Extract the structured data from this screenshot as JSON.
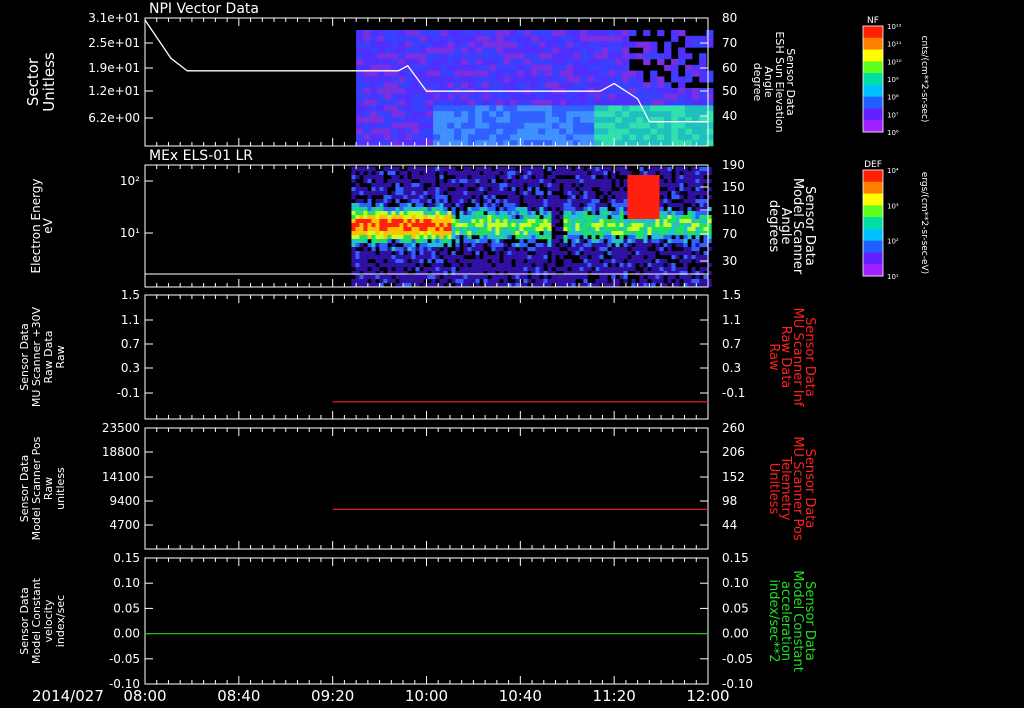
{
  "footer": {
    "date": "2014/027",
    "time_ticks": [
      "08:00",
      "08:40",
      "09:20",
      "10:00",
      "10:40",
      "11:20",
      "12:00"
    ]
  },
  "colors": {
    "red": "#ff2020",
    "green": "#20e020",
    "white": "#ffffff"
  },
  "chart_data": [
    {
      "type": "heatmap",
      "title": "NPI Vector Data",
      "ylabel": [
        "Sector",
        "Unitless"
      ],
      "yticks": [
        "3.1e+01",
        "2.5e+01",
        "1.9e+01",
        "1.2e+01",
        "6.2e+00"
      ],
      "y2label": [
        "Sensor Data",
        "ESH Sun Elevation",
        "Angle",
        "degree"
      ],
      "y2ticks": [
        "80",
        "70",
        "60",
        "50",
        "40"
      ],
      "y2lim": [
        32,
        80
      ],
      "overlay_line": {
        "x": [
          "08:00",
          "08:11",
          "08:18",
          "09:40",
          "09:48",
          "09:52",
          "10:00",
          "10:35",
          "11:14",
          "11:20",
          "11:30",
          "11:35",
          "12:00"
        ],
        "y": [
          80,
          65,
          60,
          60,
          60,
          62,
          52,
          52,
          52,
          55,
          49,
          40,
          40
        ]
      },
      "colorbar": {
        "label": "NF",
        "units": "cnts/(cm**2-sr-sec)",
        "ticks": [
          "10¹²",
          "10¹¹",
          "10¹⁰",
          "10⁹",
          "10⁸",
          "10⁷",
          "10⁶"
        ]
      }
    },
    {
      "type": "heatmap",
      "title": "MEx ELS-01 LR",
      "ylabel": [
        "Electron Energy",
        "eV"
      ],
      "yticks": [
        "10²",
        "10¹"
      ],
      "y2label": [
        "Sensor Data",
        "Model Scanner",
        "Angle",
        "degrees"
      ],
      "y2ticks": [
        "190",
        "150",
        "110",
        "70",
        "30"
      ],
      "y2lim": [
        0,
        190
      ],
      "overlay_line": {
        "x": [
          "08:00",
          "12:00"
        ],
        "y": [
          8,
          8
        ]
      },
      "colorbar": {
        "label": "DEF",
        "units": "ergs/(cm**2-sr-sec-eV)",
        "ticks": [
          "10⁴",
          "10³",
          "10²",
          "10¹"
        ]
      }
    },
    {
      "type": "line",
      "ylabel": [
        "Sensor Data",
        "MU Scanner +30V",
        "Raw Data",
        "Raw"
      ],
      "yticks": [
        "1.5",
        "1.1",
        "0.7",
        "0.3",
        "-0.1"
      ],
      "ylim": [
        -0.3,
        1.5
      ],
      "y2label": [
        "Sensor Data",
        "MU Scanner Inf",
        "Raw Data",
        "Raw"
      ],
      "y2ticks": [
        "1.5",
        "1.1",
        "0.7",
        "0.3",
        "-0.1"
      ],
      "series": [
        {
          "x": [
            "09:20",
            "12:00"
          ],
          "y": [
            -0.05,
            -0.05
          ],
          "color": "#e02020"
        }
      ]
    },
    {
      "type": "line",
      "ylabel": [
        "Sensor Data",
        "Model Scanner Pos",
        "Raw",
        "unitless"
      ],
      "yticks": [
        "23500",
        "18800",
        "14100",
        "9400",
        "4700"
      ],
      "ylim": [
        0,
        23500
      ],
      "y2label": [
        "Sensor Data",
        "MU Scanner Pos",
        "Telemetry",
        "Unitless"
      ],
      "y2ticks": [
        "260",
        "206",
        "152",
        "98",
        "44"
      ],
      "y2lim": [
        0,
        260
      ],
      "series": [
        {
          "x": [
            "09:20",
            "12:00"
          ],
          "y": [
            7700,
            7700
          ],
          "color": "#e02020"
        }
      ]
    },
    {
      "type": "line",
      "ylabel": [
        "Sensor Data",
        "Model Constant",
        "velocity",
        "index/sec"
      ],
      "yticks": [
        "0.15",
        "0.10",
        "0.05",
        "0.00",
        "-0.05",
        "-0.10"
      ],
      "ylim": [
        -0.1,
        0.15
      ],
      "y2label": [
        "Sensor Data",
        "Model Constant",
        "acceleration",
        "index/sec**2"
      ],
      "y2ticks": [
        "0.15",
        "0.10",
        "0.05",
        "0.00",
        "-0.05",
        "-0.10"
      ],
      "series": [
        {
          "x": [
            "08:00",
            "12:00"
          ],
          "y": [
            0.0,
            0.0
          ],
          "color": "#20c020"
        }
      ]
    }
  ]
}
